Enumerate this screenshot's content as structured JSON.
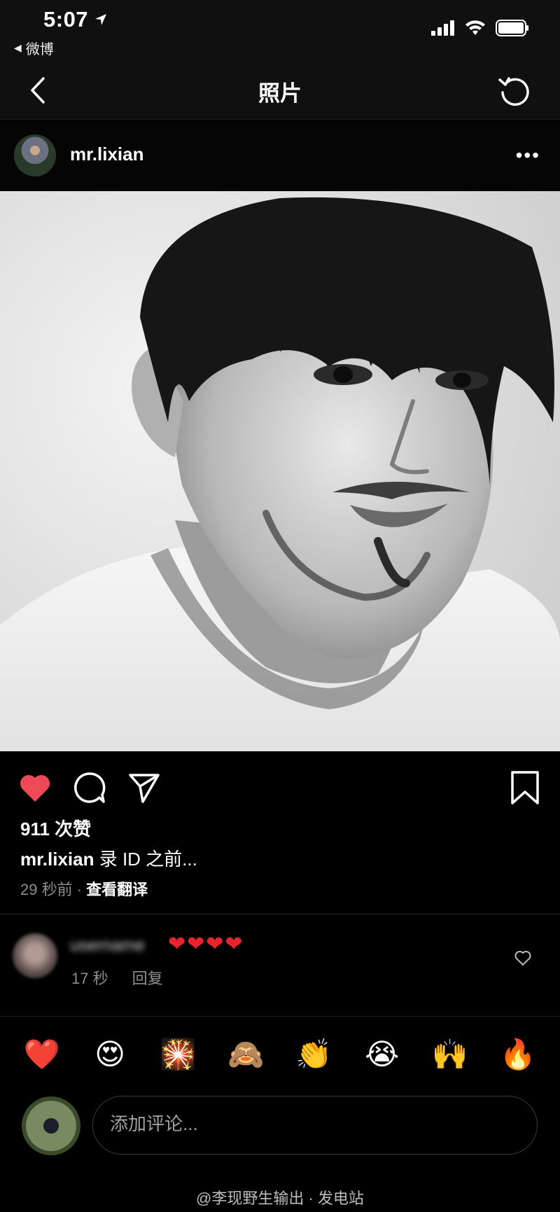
{
  "status_bar": {
    "time": "5:07",
    "back_app": "微博"
  },
  "nav": {
    "title": "照片"
  },
  "post": {
    "username": "mr.lixian",
    "likes": "911 次赞",
    "caption_user": "mr.lixian",
    "caption_text": "录 ID 之前...",
    "time_ago": "29 秒前",
    "separator": "·",
    "translate": "查看翻译"
  },
  "comment": {
    "name": "username",
    "hearts": "❤❤❤❤",
    "time": "17 秒",
    "reply": "回复"
  },
  "emojis": [
    "❤️",
    "😍",
    "🎇",
    "🙈",
    "👏",
    "😭",
    "🙌",
    "🔥"
  ],
  "compose": {
    "placeholder": "添加评论..."
  },
  "watermark": "@李现野生输出 · 发电站",
  "colors": {
    "like_red": "#ED4956",
    "background": "#000000"
  }
}
